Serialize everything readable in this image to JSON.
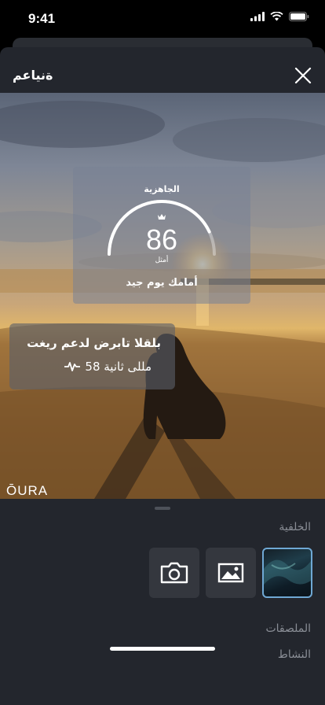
{
  "status_bar": {
    "time": "9:41"
  },
  "header": {
    "title": "ةنياعم"
  },
  "readiness": {
    "label": "الجاهزية",
    "score": "86",
    "status": "أمثل",
    "message": "أمامك يوم جيد",
    "score_fraction": 0.86
  },
  "hrv": {
    "title": "بلقلا تابرض لدعم ريغت",
    "value": "58 مللى ثانية"
  },
  "branding": {
    "logo": "ŌURA"
  },
  "panel": {
    "background_label": "الخلفية",
    "stickers_label": "الملصقات",
    "activity_label": "النشاط"
  },
  "colors": {
    "sheet_background": "#23262d",
    "tile_background": "#34373e",
    "selected_border": "#6fa8d4",
    "muted_text": "#8a8e96"
  },
  "icons": {
    "close": "close-icon",
    "camera": "camera-icon",
    "gallery": "image-gallery-icon",
    "crown": "crown-icon",
    "heartbeat": "heartbeat-icon"
  }
}
